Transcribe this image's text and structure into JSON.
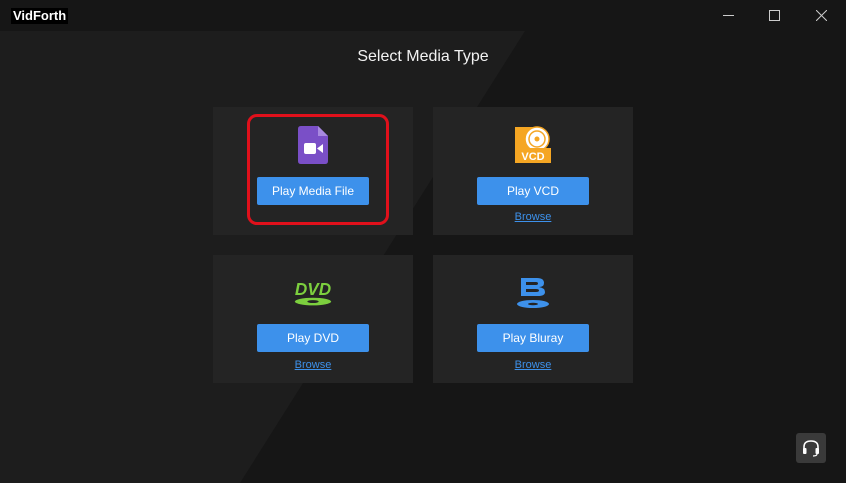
{
  "window": {
    "title": "VidForth",
    "controls": {
      "minimize": "minimize-icon",
      "maximize": "maximize-icon",
      "close": "close-icon"
    }
  },
  "heading": "Select Media Type",
  "cards": {
    "media_file": {
      "icon": "video-file-icon",
      "button": "Play Media File"
    },
    "vcd": {
      "icon": "vcd-disc-icon",
      "button": "Play VCD",
      "browse": "Browse"
    },
    "dvd": {
      "icon": "dvd-logo-icon",
      "button": "Play DVD",
      "browse": "Browse"
    },
    "bluray": {
      "icon": "bluray-logo-icon",
      "button": "Play Bluray",
      "browse": "Browse"
    }
  },
  "support": {
    "icon": "headset-icon"
  },
  "colors": {
    "background": "#161616",
    "card": "#242424",
    "accent": "#3d91eb",
    "highlight": "#e0101b",
    "vcd_orange": "#f5a623",
    "dvd_green": "#7ccf3e",
    "media_purple": "#7a4fc7"
  }
}
